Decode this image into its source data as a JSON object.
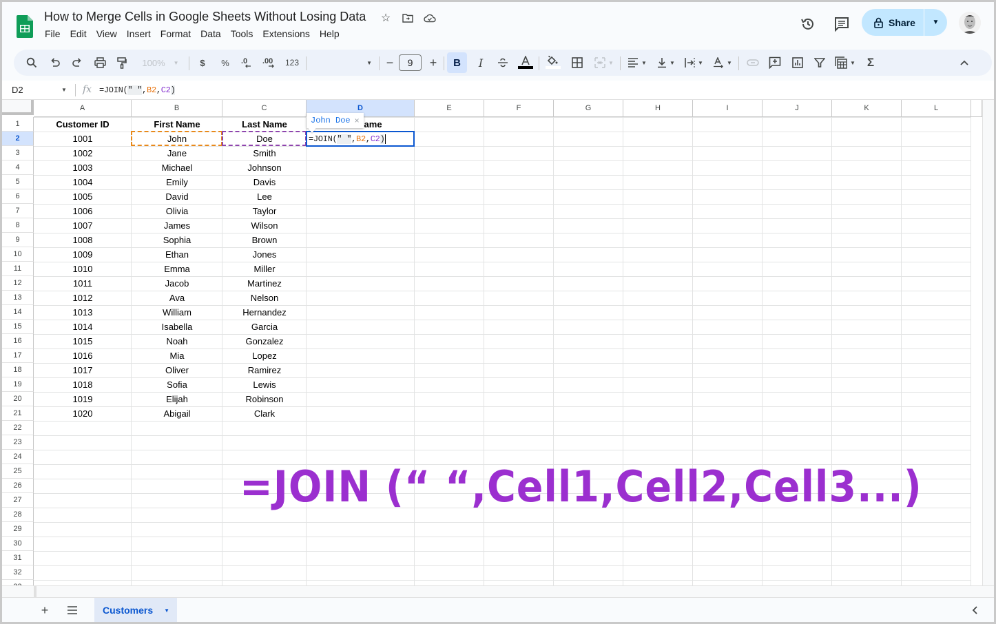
{
  "app": {
    "doc_title": "How to Merge Cells in Google Sheets Without Losing Data",
    "menu": [
      "File",
      "Edit",
      "View",
      "Insert",
      "Format",
      "Data",
      "Tools",
      "Extensions",
      "Help"
    ],
    "share_label": "Share",
    "brand_color": "#0f9d58",
    "accent_color": "#0b57d0"
  },
  "toolbar": {
    "zoom": "100%",
    "currency": "$",
    "percent": "%",
    "decrease_decimal": ".0",
    "increase_decimal": ".00",
    "number_format": "123",
    "font": "",
    "font_size": "9",
    "bold": "B",
    "italic": "I",
    "sum": "Σ"
  },
  "formula_bar": {
    "name_box": "D2",
    "fx": "fx",
    "formula_parts": [
      "=JOIN(",
      "\" \"",
      ",",
      "B2",
      ",",
      "C2",
      ")"
    ]
  },
  "grid": {
    "columns": [
      "A",
      "B",
      "C",
      "D",
      "E",
      "F",
      "G",
      "H",
      "I",
      "J",
      "K",
      "L"
    ],
    "selected_column": "D",
    "selected_row": 2,
    "row_count_visible": 33,
    "headers": [
      "Customer ID",
      "First Name",
      "Last Name",
      "Full Name"
    ],
    "rows": [
      [
        "1001",
        "John",
        "Doe"
      ],
      [
        "1002",
        "Jane",
        "Smith"
      ],
      [
        "1003",
        "Michael",
        "Johnson"
      ],
      [
        "1004",
        "Emily",
        "Davis"
      ],
      [
        "1005",
        "David",
        "Lee"
      ],
      [
        "1006",
        "Olivia",
        "Taylor"
      ],
      [
        "1007",
        "James",
        "Wilson"
      ],
      [
        "1008",
        "Sophia",
        "Brown"
      ],
      [
        "1009",
        "Ethan",
        "Jones"
      ],
      [
        "1010",
        "Emma",
        "Miller"
      ],
      [
        "1011",
        "Jacob",
        "Martinez"
      ],
      [
        "1012",
        "Ava",
        "Nelson"
      ],
      [
        "1013",
        "William",
        "Hernandez"
      ],
      [
        "1014",
        "Isabella",
        "Garcia"
      ],
      [
        "1015",
        "Noah",
        "Gonzalez"
      ],
      [
        "1016",
        "Mia",
        "Lopez"
      ],
      [
        "1017",
        "Oliver",
        "Ramirez"
      ],
      [
        "1018",
        "Sofia",
        "Lewis"
      ],
      [
        "1019",
        "Elijah",
        "Robinson"
      ],
      [
        "1020",
        "Abigail",
        "Clark"
      ]
    ],
    "edit_formula_parts": [
      "=JOIN(",
      "\" \"",
      ",",
      "B2",
      ",",
      "C2",
      ")"
    ],
    "preview_tooltip": "John Doe",
    "reference_colors": {
      "B2": "#e8710a",
      "C2": "#8430ce"
    }
  },
  "annotation": {
    "text": "=JOIN (“ “,Cell1,Cell2,Cell3...)",
    "color": "#9b2fcf"
  },
  "sheets": {
    "tabs": [
      {
        "label": "Customers",
        "active": true
      }
    ]
  }
}
